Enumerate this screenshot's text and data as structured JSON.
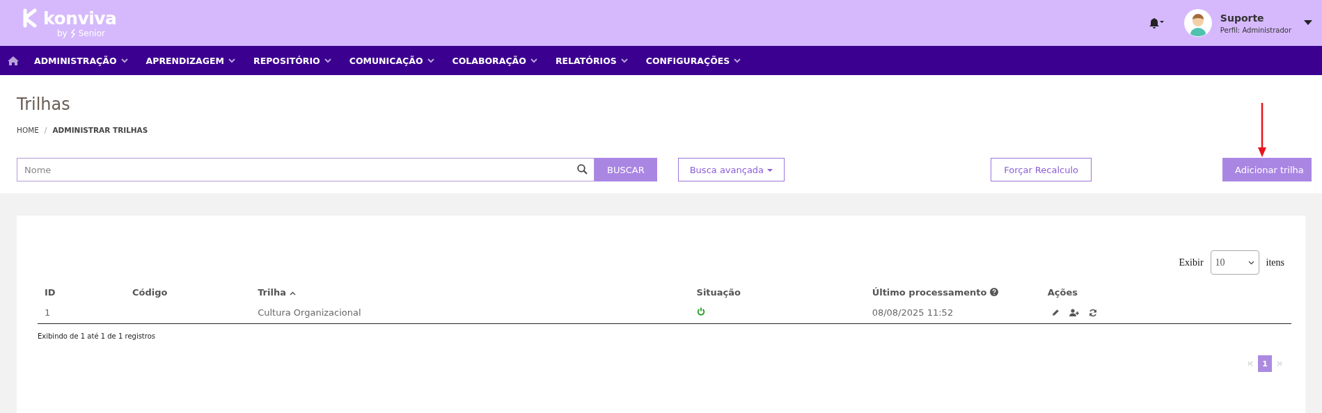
{
  "header": {
    "logo": {
      "name": "konviva",
      "by": "by",
      "brand": "Senior"
    },
    "user": {
      "name": "Suporte",
      "profile": "Perfil: Administrador"
    }
  },
  "nav": {
    "items": [
      {
        "label": "ADMINISTRAÇÃO"
      },
      {
        "label": "APRENDIZAGEM"
      },
      {
        "label": "REPOSITÓRIO"
      },
      {
        "label": "COMUNICAÇÃO"
      },
      {
        "label": "COLABORAÇÃO"
      },
      {
        "label": "RELATÓRIOS"
      },
      {
        "label": "CONFIGURAÇÕES"
      }
    ]
  },
  "page": {
    "title": "Trilhas",
    "breadcrumb": [
      "HOME",
      "ADMINISTRAR TRILHAS"
    ],
    "breadcrumb_separator": "/",
    "search": {
      "placeholder": "Nome"
    },
    "search_button": "BUSCAR",
    "advanced_button": "Busca avançada",
    "recalc_button": "Forçar Recalculo",
    "add_button": "Adicionar trilha"
  },
  "table": {
    "page_size": {
      "label": "Exibir",
      "value": "10",
      "suffix": "itens"
    },
    "columns": [
      {
        "label": "ID",
        "sorted": false,
        "help": false
      },
      {
        "label": "Código",
        "sorted": false,
        "help": false
      },
      {
        "label": "Trilha",
        "sorted": true,
        "help": false
      },
      {
        "label": "Situação",
        "sorted": false,
        "help": false
      },
      {
        "label": "Último processamento",
        "sorted": false,
        "help": true
      },
      {
        "label": "Ações",
        "sorted": false,
        "help": false
      }
    ],
    "rows": [
      {
        "id": "1",
        "name": "Cultura Organizacional",
        "active": true,
        "last_processed": "08/08/2025 11:52"
      }
    ],
    "info": "Exibindo de 1 até 1 de 1 registros",
    "pagination": [
      {
        "label": "1",
        "selected": true
      }
    ]
  }
}
